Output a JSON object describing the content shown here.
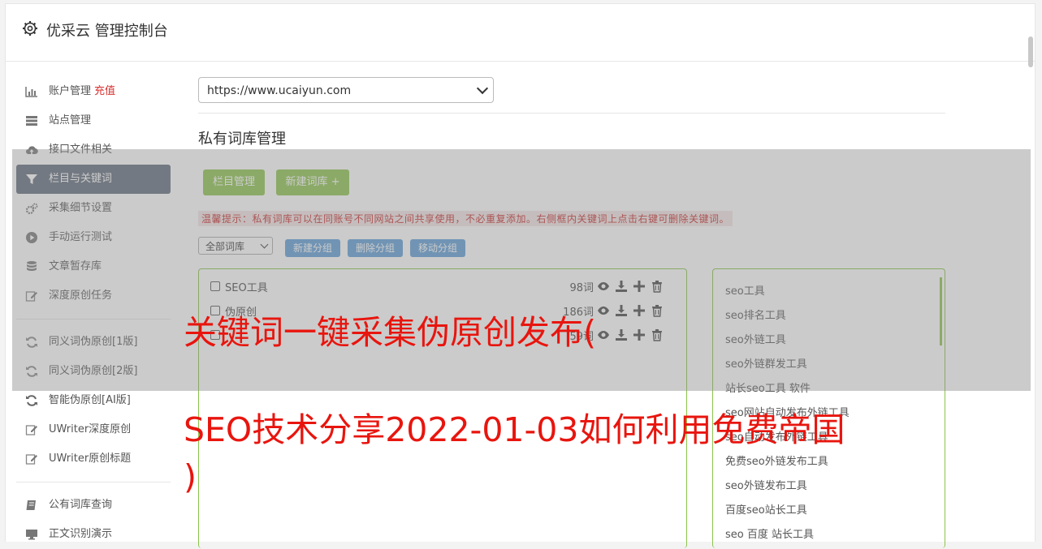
{
  "header": {
    "title": "优采云 管理控制台",
    "icon": "gear-icon"
  },
  "sidebar": {
    "items": [
      {
        "label": "账户管理",
        "badge": "充值",
        "icon": "bar-chart-icon"
      },
      {
        "label": "站点管理",
        "icon": "server-icon"
      },
      {
        "label": "接口文件相关",
        "icon": "cloud-upload-icon"
      },
      {
        "label": "栏目与关键词",
        "icon": "filter-icon",
        "active": true
      },
      {
        "label": "采集细节设置",
        "icon": "gears-icon"
      },
      {
        "label": "手动运行测试",
        "icon": "play-circle-icon"
      },
      {
        "label": "文章暂存库",
        "icon": "database-icon"
      },
      {
        "label": "深度原创任务",
        "icon": "edit-icon"
      },
      {
        "label": "同义词伪原创[1版]",
        "icon": "refresh-icon"
      },
      {
        "label": "同义词伪原创[2版]",
        "icon": "refresh-icon"
      },
      {
        "label": "智能伪原创[AI版]",
        "icon": "refresh-icon"
      },
      {
        "label": "UWriter深度原创",
        "icon": "edit-icon"
      },
      {
        "label": "UWriter原创标题",
        "icon": "edit-icon"
      },
      {
        "label": "公有词库查询",
        "icon": "book-icon"
      },
      {
        "label": "正文识别演示",
        "icon": "monitor-icon"
      }
    ]
  },
  "main": {
    "site_select": {
      "value": "https://www.ucaiyun.com"
    },
    "section_title": "私有词库管理",
    "buttons": {
      "column_manage": "栏目管理",
      "new_library": "新建词库 +"
    },
    "tip": "温馨提示：私有词库可以在同账号不同网站之间共享使用，不必重复添加。右侧框内关键词上点击右键可删除关键词。",
    "library_filter": "全部词库",
    "group_buttons": {
      "new_group": "新建分组",
      "delete_group": "删除分组",
      "move_group": "移动分组"
    },
    "libraries": [
      {
        "name": "SEO工具",
        "count": "98词"
      },
      {
        "name": "伪原创",
        "count": "186词"
      },
      {
        "name": "",
        "count": "59词"
      }
    ],
    "keywords": [
      "seo工具",
      "seo排名工具",
      "seo外链工具",
      "seo外链群发工具",
      "站长seo工具 软件",
      "seo网站自动发布外链工具",
      "seo自动发布外链工具",
      "免费seo外链发布工具",
      "seo外链发布工具",
      "百度seo站长工具",
      "seo 百度 站长工具"
    ]
  },
  "overlay": {
    "headline_line1": "关键词一键采集伪原创发布(",
    "headline_line2": "SEO技术分享2022-01-03如何利用免费帝国",
    "headline_line3": ")",
    "headline_color": "#e8150e"
  },
  "colors": {
    "green": "#8bc34a",
    "blue": "#5b9bd5",
    "active_nav": "#5f6b7a",
    "tip_red": "#c62828"
  }
}
